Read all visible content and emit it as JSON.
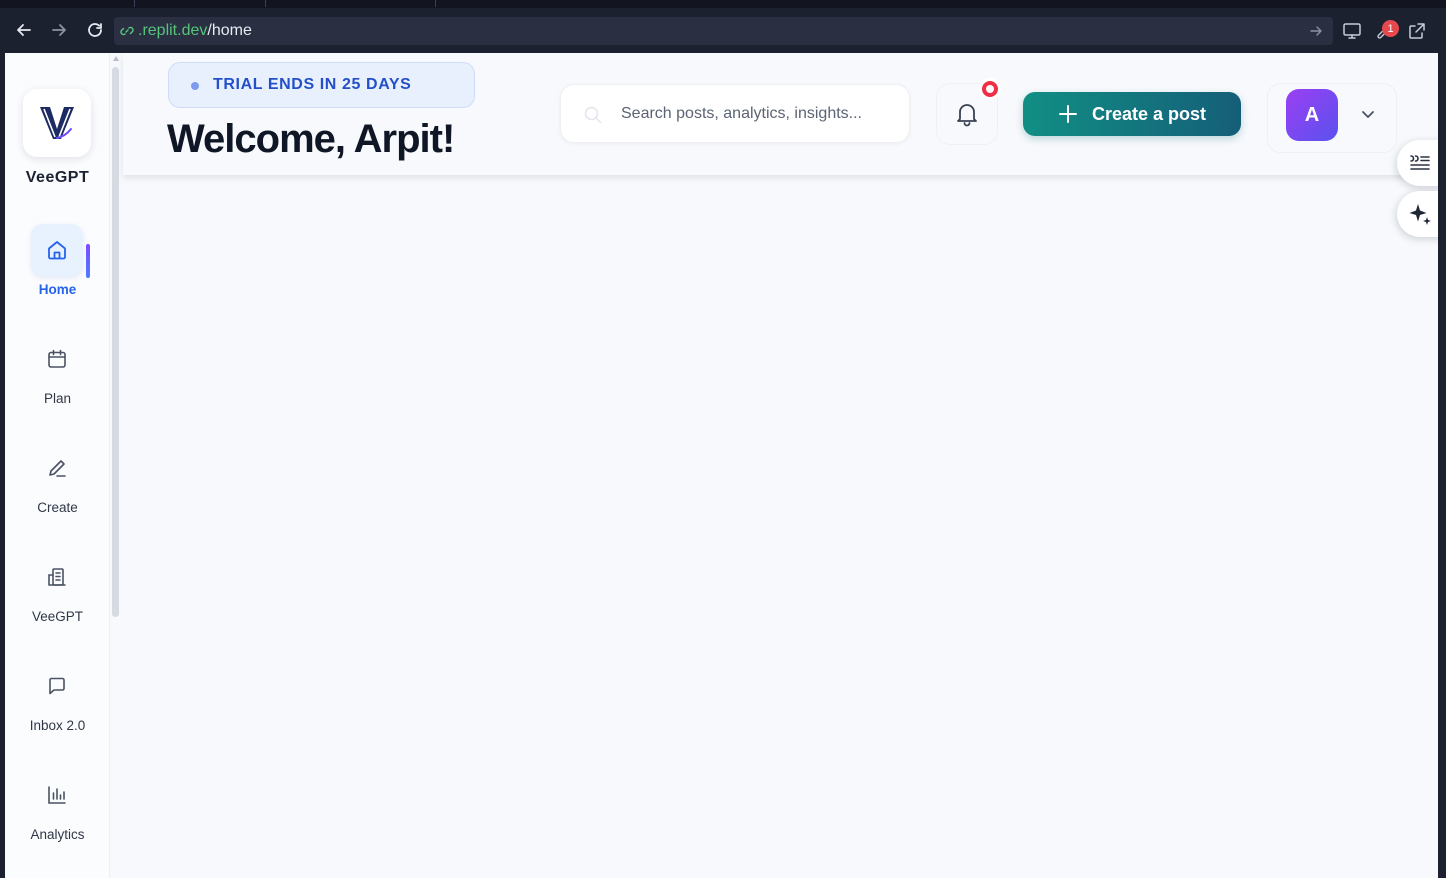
{
  "browser": {
    "url_domain": ".replit.dev",
    "url_path": "/home",
    "extension_badge_count": "1"
  },
  "sidebar": {
    "brand": "VeeGPT",
    "items": [
      {
        "label": "Home",
        "icon": "home-icon",
        "active": true
      },
      {
        "label": "Plan",
        "icon": "calendar-icon",
        "active": false
      },
      {
        "label": "Create",
        "icon": "pen-icon",
        "active": false
      },
      {
        "label": "VeeGPT",
        "icon": "building-icon",
        "active": false
      },
      {
        "label": "Inbox 2.0",
        "icon": "chat-icon",
        "active": false
      },
      {
        "label": "Analytics",
        "icon": "bar-chart-icon",
        "active": false
      }
    ]
  },
  "header": {
    "trial_text": "TRIAL ENDS IN 25 DAYS",
    "welcome": "Welcome, Arpit!",
    "search_placeholder": "Search posts, analytics, insights...",
    "create_label": "Create a post",
    "avatar_initial": "A"
  },
  "colors": {
    "accent_blue": "#2563eb",
    "create_gradient_start": "#118f84",
    "create_gradient_end": "#155e78",
    "notification_red": "#ef2f45",
    "avatar_gradient_start": "#9b3ff2",
    "avatar_gradient_end": "#5a52ee"
  }
}
